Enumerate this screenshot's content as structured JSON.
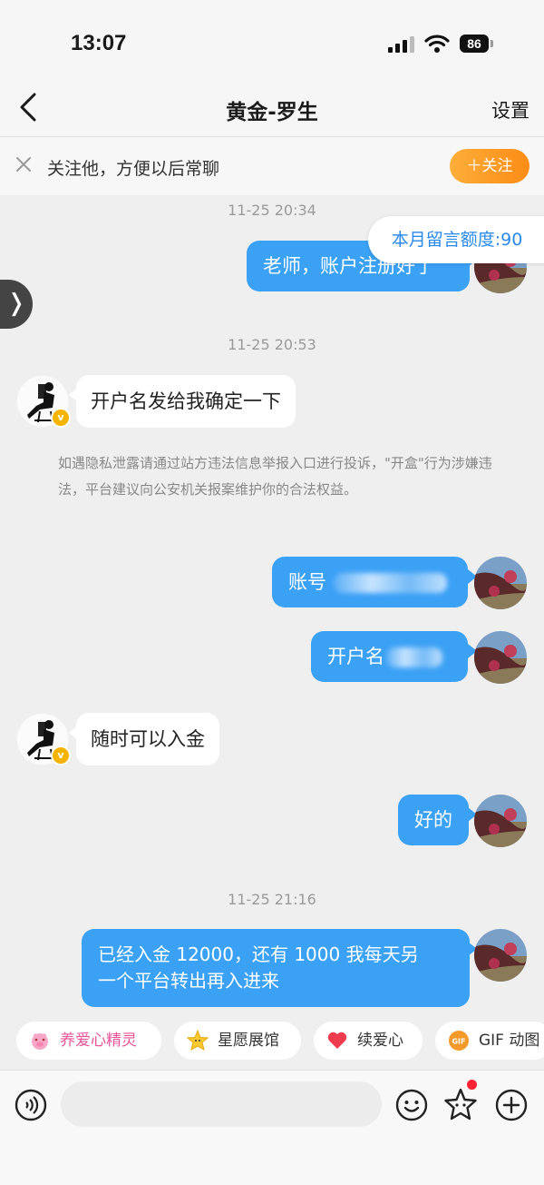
{
  "status": {
    "time": "13:07",
    "battery": "86"
  },
  "nav": {
    "title": "黄金-罗生",
    "settings": "设置"
  },
  "follow_bar": {
    "text": "关注他，方便以后常聊",
    "button": "＋关注"
  },
  "quota": "本月留言额度:90",
  "side_tab": "❭",
  "messages": {
    "ts1": "11-25 20:34",
    "m1": "老师，账户注册好了",
    "ts2": "11-25 20:53",
    "m2": "开户名发给我确定一下",
    "notice": "如遇隐私泄露请通过站方违法信息举报入口进行投诉，\"开盒\"行为涉嫌违法，平台建议向公安机关报案维护你的合法权益。",
    "m3": "账号",
    "m4": "开户名",
    "m5": "随时可以入金",
    "m6": "好的",
    "ts3": "11-25 21:16",
    "m7_line1": "已经入金 12000，还有 1000 我每天另",
    "m7_line2": "一个平台转出再入进来"
  },
  "chips": [
    "养爱心精灵",
    "星愿展馆",
    "续爱心",
    "GIF 动图"
  ],
  "colors": {
    "bubble_out": "#3ba1f5",
    "accent_orange": "#fb8c15",
    "chip_pink": "#e8559a"
  }
}
